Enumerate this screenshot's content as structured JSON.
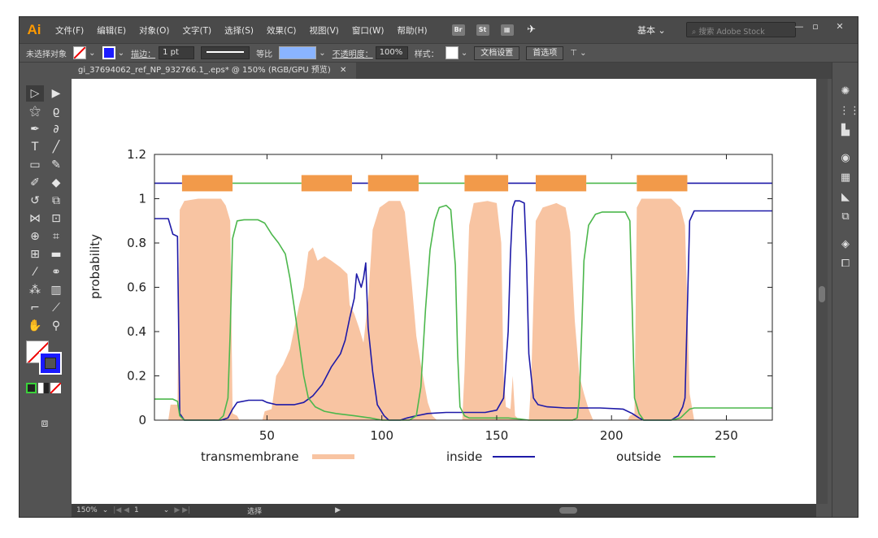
{
  "app": {
    "logo": "Ai",
    "menu": [
      "文件(F)",
      "编辑(E)",
      "对象(O)",
      "文字(T)",
      "选择(S)",
      "效果(C)",
      "视图(V)",
      "窗口(W)",
      "帮助(H)"
    ],
    "workspace": "基本 ⌄",
    "stock_search_placeholder": "搜索 Adobe Stock",
    "st_label": "St"
  },
  "control_bar": {
    "selection_status": "未选择对象",
    "stroke_label": "描边：",
    "stroke_value": "1 pt",
    "profile_label": "等比",
    "opacity_label": "不透明度：",
    "opacity_value": "100%",
    "style_label": "样式：",
    "doc_setup_button": "文档设置",
    "preferences_button": "首选项"
  },
  "document": {
    "tab_title": "gi_37694062_ref_NP_932766.1_.eps* @ 150% (RGB/GPU 预览)",
    "close_glyph": "✕"
  },
  "status_bar": {
    "zoom": "150%",
    "artboard": "1",
    "mode": "选择"
  },
  "colors": {
    "transmembrane": "#f8c4a2",
    "inside": "#1e1aa8",
    "outside": "#4cb74c",
    "topology_bar": "#f29a4a",
    "ui_dark": "#535353"
  },
  "chart_data": {
    "type": "area",
    "title": "",
    "xlabel": "",
    "ylabel": "probability",
    "xlim": [
      1,
      270
    ],
    "ylim": [
      0,
      1.2
    ],
    "xticks": [
      50,
      100,
      150,
      200,
      250
    ],
    "yticks": [
      0,
      0.2,
      0.4,
      0.6,
      0.8,
      1,
      1.2
    ],
    "yticklabels": [
      "0",
      "0.2",
      "0.4",
      "0.6",
      "0.8",
      "1",
      "1.2"
    ],
    "legend_position": "bottom",
    "series": [
      {
        "name": "transmembrane",
        "style": "filled-area",
        "points": [
          [
            1,
            0
          ],
          [
            7,
            0
          ],
          [
            8,
            0.07
          ],
          [
            11,
            0.07
          ],
          [
            12,
            0.95
          ],
          [
            14,
            0.99
          ],
          [
            20,
            1.0
          ],
          [
            30,
            1.0
          ],
          [
            32,
            0.97
          ],
          [
            34,
            0.9
          ],
          [
            35,
            0.03
          ],
          [
            37,
            0.02
          ],
          [
            38,
            0
          ],
          [
            48,
            0
          ],
          [
            49,
            0.04
          ],
          [
            52,
            0.05
          ],
          [
            54,
            0.2
          ],
          [
            57,
            0.25
          ],
          [
            60,
            0.32
          ],
          [
            64,
            0.52
          ],
          [
            66,
            0.6
          ],
          [
            68,
            0.76
          ],
          [
            70,
            0.78
          ],
          [
            72,
            0.72
          ],
          [
            75,
            0.74
          ],
          [
            78,
            0.72
          ],
          [
            82,
            0.69
          ],
          [
            85,
            0.66
          ],
          [
            86,
            0.52
          ],
          [
            88,
            0.48
          ],
          [
            90,
            0.42
          ],
          [
            92,
            0.35
          ],
          [
            94,
            0.54
          ],
          [
            96,
            0.86
          ],
          [
            99,
            0.96
          ],
          [
            103,
            0.99
          ],
          [
            108,
            0.99
          ],
          [
            110,
            0.94
          ],
          [
            113,
            0.62
          ],
          [
            115,
            0.38
          ],
          [
            117,
            0.25
          ],
          [
            120,
            0.08
          ],
          [
            122,
            0.02
          ],
          [
            124,
            0
          ],
          [
            135,
            0
          ],
          [
            136,
            0.22
          ],
          [
            138,
            0.88
          ],
          [
            140,
            0.98
          ],
          [
            146,
            0.99
          ],
          [
            150,
            0.98
          ],
          [
            152,
            0.8
          ],
          [
            153,
            0.2
          ],
          [
            154,
            0.06
          ],
          [
            156,
            0.05
          ],
          [
            157,
            0.2
          ],
          [
            158,
            0.02
          ],
          [
            160,
            0
          ],
          [
            164,
            0
          ],
          [
            165,
            0.17
          ],
          [
            167,
            0.9
          ],
          [
            170,
            0.96
          ],
          [
            176,
            0.98
          ],
          [
            180,
            0.96
          ],
          [
            182,
            0.85
          ],
          [
            184,
            0.45
          ],
          [
            186,
            0.2
          ],
          [
            188,
            0.12
          ],
          [
            190,
            0.05
          ],
          [
            192,
            0
          ],
          [
            207,
            0
          ],
          [
            208,
            0.02
          ],
          [
            210,
            0.03
          ],
          [
            211,
            0.96
          ],
          [
            213,
            1.0
          ],
          [
            226,
            1.0
          ],
          [
            230,
            0.96
          ],
          [
            232,
            0.88
          ],
          [
            234,
            0.12
          ],
          [
            236,
            0
          ],
          [
            270,
            0
          ]
        ]
      },
      {
        "name": "inside",
        "style": "line",
        "points": [
          [
            1,
            0.91
          ],
          [
            7,
            0.91
          ],
          [
            9,
            0.84
          ],
          [
            11,
            0.83
          ],
          [
            12,
            0.03
          ],
          [
            14,
            0
          ],
          [
            30,
            0
          ],
          [
            33,
            0.01
          ],
          [
            35,
            0.05
          ],
          [
            37,
            0.08
          ],
          [
            42,
            0.09
          ],
          [
            48,
            0.09
          ],
          [
            50,
            0.08
          ],
          [
            54,
            0.07
          ],
          [
            62,
            0.07
          ],
          [
            66,
            0.08
          ],
          [
            70,
            0.11
          ],
          [
            74,
            0.16
          ],
          [
            78,
            0.24
          ],
          [
            82,
            0.3
          ],
          [
            84,
            0.36
          ],
          [
            86,
            0.46
          ],
          [
            88,
            0.55
          ],
          [
            89,
            0.66
          ],
          [
            91,
            0.6
          ],
          [
            92,
            0.64
          ],
          [
            93,
            0.71
          ],
          [
            94,
            0.42
          ],
          [
            96,
            0.22
          ],
          [
            98,
            0.07
          ],
          [
            101,
            0.02
          ],
          [
            103,
            0
          ],
          [
            108,
            0
          ],
          [
            111,
            0.01
          ],
          [
            115,
            0.02
          ],
          [
            120,
            0.03
          ],
          [
            128,
            0.035
          ],
          [
            145,
            0.035
          ],
          [
            150,
            0.045
          ],
          [
            153,
            0.1
          ],
          [
            155,
            0.4
          ],
          [
            156,
            0.75
          ],
          [
            157,
            0.96
          ],
          [
            158,
            0.99
          ],
          [
            160,
            0.99
          ],
          [
            162,
            0.98
          ],
          [
            163,
            0.72
          ],
          [
            164,
            0.3
          ],
          [
            166,
            0.1
          ],
          [
            168,
            0.07
          ],
          [
            172,
            0.06
          ],
          [
            180,
            0.055
          ],
          [
            195,
            0.055
          ],
          [
            205,
            0.05
          ],
          [
            209,
            0.03
          ],
          [
            212,
            0.01
          ],
          [
            214,
            0
          ],
          [
            226,
            0
          ],
          [
            229,
            0.02
          ],
          [
            231,
            0.06
          ],
          [
            232,
            0.1
          ],
          [
            233,
            0.5
          ],
          [
            234,
            0.9
          ],
          [
            236,
            0.945
          ],
          [
            270,
            0.945
          ]
        ]
      },
      {
        "name": "outside",
        "style": "line",
        "points": [
          [
            1,
            0.095
          ],
          [
            9,
            0.095
          ],
          [
            11,
            0.085
          ],
          [
            12,
            0.02
          ],
          [
            14,
            0
          ],
          [
            29,
            0
          ],
          [
            31,
            0.02
          ],
          [
            33,
            0.1
          ],
          [
            34,
            0.4
          ],
          [
            35,
            0.82
          ],
          [
            37,
            0.9
          ],
          [
            40,
            0.905
          ],
          [
            46,
            0.905
          ],
          [
            49,
            0.89
          ],
          [
            52,
            0.84
          ],
          [
            55,
            0.8
          ],
          [
            58,
            0.75
          ],
          [
            60,
            0.64
          ],
          [
            62,
            0.5
          ],
          [
            64,
            0.35
          ],
          [
            66,
            0.2
          ],
          [
            68,
            0.1
          ],
          [
            71,
            0.06
          ],
          [
            75,
            0.04
          ],
          [
            80,
            0.03
          ],
          [
            88,
            0.02
          ],
          [
            95,
            0.01
          ],
          [
            100,
            0
          ],
          [
            112,
            0
          ],
          [
            115,
            0.02
          ],
          [
            117,
            0.15
          ],
          [
            119,
            0.5
          ],
          [
            121,
            0.77
          ],
          [
            123,
            0.9
          ],
          [
            125,
            0.96
          ],
          [
            128,
            0.97
          ],
          [
            130,
            0.95
          ],
          [
            132,
            0.7
          ],
          [
            133,
            0.3
          ],
          [
            134,
            0.06
          ],
          [
            136,
            0.02
          ],
          [
            138,
            0.01
          ],
          [
            150,
            0.01
          ],
          [
            155,
            0.01
          ],
          [
            160,
            0.005
          ],
          [
            164,
            0
          ],
          [
            183,
            0
          ],
          [
            185,
            0.01
          ],
          [
            186,
            0.1
          ],
          [
            187,
            0.4
          ],
          [
            188,
            0.72
          ],
          [
            190,
            0.88
          ],
          [
            193,
            0.93
          ],
          [
            196,
            0.94
          ],
          [
            206,
            0.94
          ],
          [
            208,
            0.9
          ],
          [
            209,
            0.5
          ],
          [
            210,
            0.1
          ],
          [
            212,
            0.03
          ],
          [
            214,
            0
          ],
          [
            226,
            0
          ],
          [
            230,
            0.01
          ],
          [
            232,
            0.03
          ],
          [
            234,
            0.05
          ],
          [
            236,
            0.055
          ],
          [
            270,
            0.055
          ]
        ]
      }
    ],
    "topology_bar": {
      "y": 1.07,
      "segments": [
        {
          "from": 1,
          "to": 13,
          "state": "inside"
        },
        {
          "from": 13,
          "to": 35,
          "state": "transmembrane"
        },
        {
          "from": 35,
          "to": 65,
          "state": "outside"
        },
        {
          "from": 65,
          "to": 87,
          "state": "transmembrane"
        },
        {
          "from": 87,
          "to": 94,
          "state": "inside"
        },
        {
          "from": 94,
          "to": 116,
          "state": "transmembrane"
        },
        {
          "from": 116,
          "to": 136,
          "state": "outside"
        },
        {
          "from": 136,
          "to": 155,
          "state": "transmembrane"
        },
        {
          "from": 155,
          "to": 167,
          "state": "inside"
        },
        {
          "from": 167,
          "to": 189,
          "state": "transmembrane"
        },
        {
          "from": 189,
          "to": 211,
          "state": "outside"
        },
        {
          "from": 211,
          "to": 233,
          "state": "transmembrane"
        },
        {
          "from": 233,
          "to": 270,
          "state": "inside"
        }
      ]
    }
  }
}
